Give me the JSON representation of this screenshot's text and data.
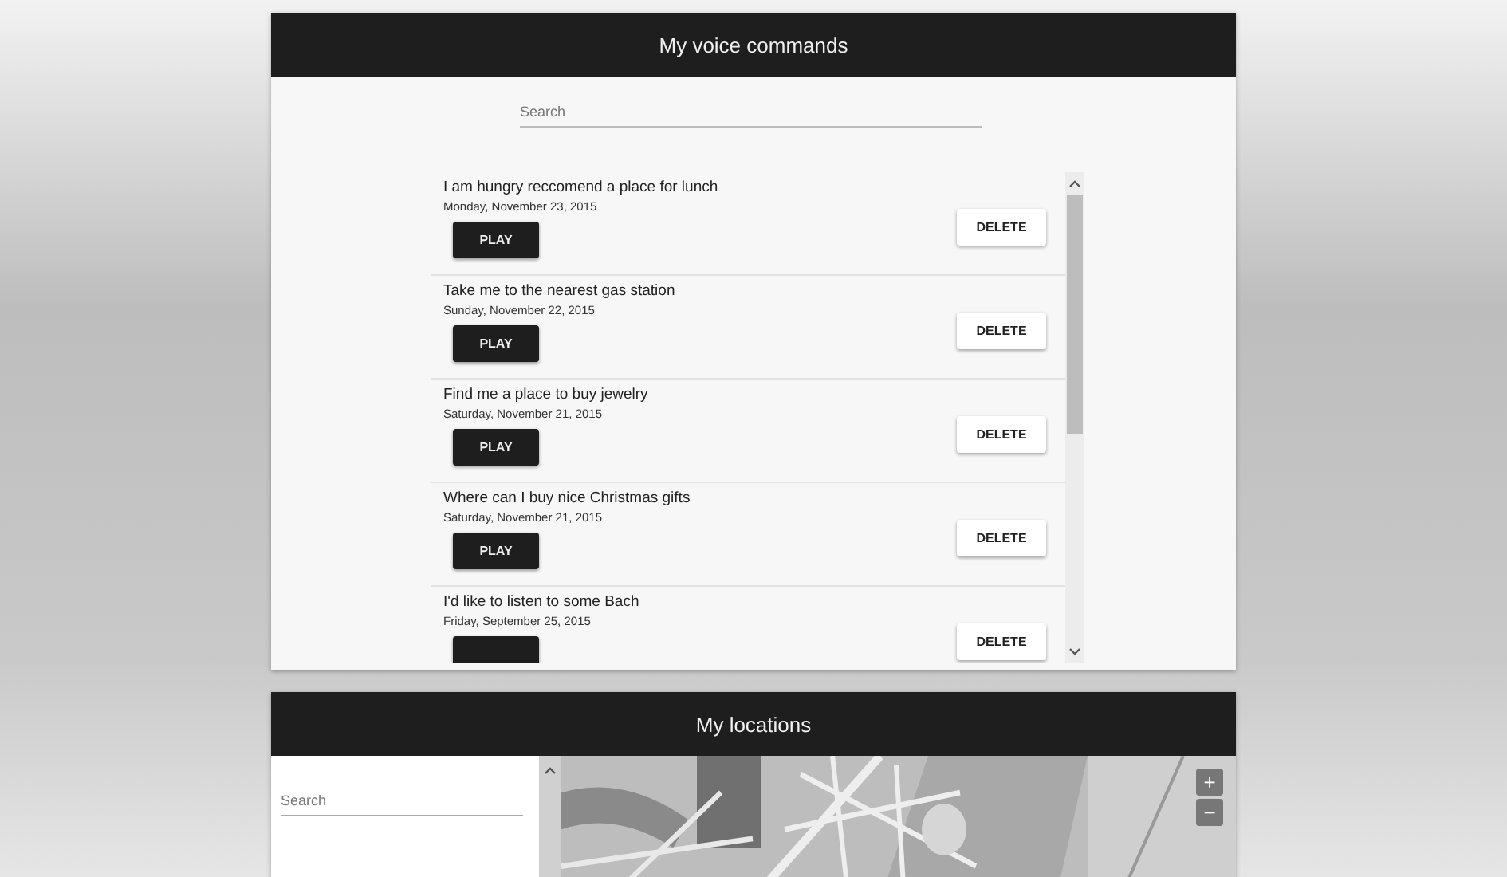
{
  "commands_panel": {
    "title": "My voice commands",
    "search": {
      "placeholder": "Search"
    },
    "items": [
      {
        "text": "I am hungry reccomend a place for lunch",
        "date": "Monday, November 23, 2015",
        "play": "PLAY",
        "delete": "DELETE"
      },
      {
        "text": "Take me to the nearest gas station",
        "date": "Sunday, November 22, 2015",
        "play": "PLAY",
        "delete": "DELETE"
      },
      {
        "text": "Find me a place to buy jewelry",
        "date": "Saturday, November 21, 2015",
        "play": "PLAY",
        "delete": "DELETE"
      },
      {
        "text": "Where can I buy nice Christmas gifts",
        "date": "Saturday, November 21, 2015",
        "play": "PLAY",
        "delete": "DELETE"
      },
      {
        "text": "I'd like to listen to some Bach",
        "date": "Friday, September 25, 2015",
        "delete": "DELETE"
      }
    ]
  },
  "locations_panel": {
    "title": "My locations",
    "search": {
      "placeholder": "Search"
    },
    "map": {
      "kind": "picture",
      "zoom_in": "+",
      "zoom_out": "−"
    }
  }
}
